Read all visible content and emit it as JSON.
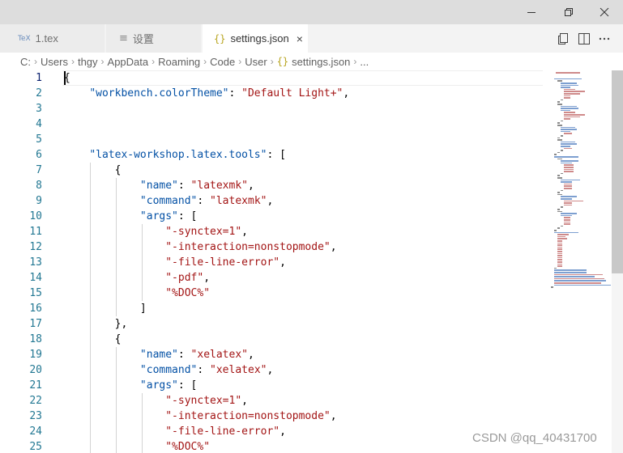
{
  "window": {
    "minimize_icon": "minimize-icon",
    "maximize_icon": "restore-icon",
    "close_icon": "close-icon"
  },
  "tabs": [
    {
      "label": "1.tex",
      "icon": "tex-file-icon",
      "active": false
    },
    {
      "label": "设置",
      "icon": "settings-icon",
      "active": false
    },
    {
      "label": "settings.json",
      "icon": "json-file-icon",
      "active": true,
      "close": "×"
    }
  ],
  "tab_actions": [
    "open-preview-icon",
    "split-editor-icon",
    "more-actions-icon"
  ],
  "breadcrumb": {
    "parts": [
      "C:",
      "Users",
      "thgy",
      "AppData",
      "Roaming",
      "Code",
      "User"
    ],
    "file_icon": "{}",
    "file": "settings.json",
    "ellipsis": "..."
  },
  "editor": {
    "current_line": 1,
    "lines": [
      {
        "n": "1",
        "code": "{"
      },
      {
        "n": "2",
        "code": "    \"workbench.colorTheme\": \"Default Light+\","
      },
      {
        "n": "3",
        "code": ""
      },
      {
        "n": "4",
        "code": ""
      },
      {
        "n": "5",
        "code": ""
      },
      {
        "n": "6",
        "code": "    \"latex-workshop.latex.tools\": ["
      },
      {
        "n": "7",
        "code": "        {"
      },
      {
        "n": "8",
        "code": "            \"name\": \"latexmk\","
      },
      {
        "n": "9",
        "code": "            \"command\": \"latexmk\","
      },
      {
        "n": "10",
        "code": "            \"args\": ["
      },
      {
        "n": "11",
        "code": "                \"-synctex=1\","
      },
      {
        "n": "12",
        "code": "                \"-interaction=nonstopmode\","
      },
      {
        "n": "13",
        "code": "                \"-file-line-error\","
      },
      {
        "n": "14",
        "code": "                \"-pdf\","
      },
      {
        "n": "15",
        "code": "                \"%DOC%\""
      },
      {
        "n": "16",
        "code": "            ]"
      },
      {
        "n": "17",
        "code": "        },"
      },
      {
        "n": "18",
        "code": "        {"
      },
      {
        "n": "19",
        "code": "            \"name\": \"xelatex\","
      },
      {
        "n": "20",
        "code": "            \"command\": \"xelatex\","
      },
      {
        "n": "21",
        "code": "            \"args\": ["
      },
      {
        "n": "22",
        "code": "                \"-synctex=1\","
      },
      {
        "n": "23",
        "code": "                \"-interaction=nonstopmode\","
      },
      {
        "n": "24",
        "code": "                \"-file-line-error\","
      },
      {
        "n": "25",
        "code": "                \"%DOC%\""
      }
    ]
  },
  "scrollbar": {
    "thumb_fraction": 0.53
  },
  "watermark": "CSDN @qq_40431700",
  "colors": {
    "key": "#0451a5",
    "string": "#a31515",
    "line_number": "#237893",
    "accent_json": "#b8a520"
  }
}
